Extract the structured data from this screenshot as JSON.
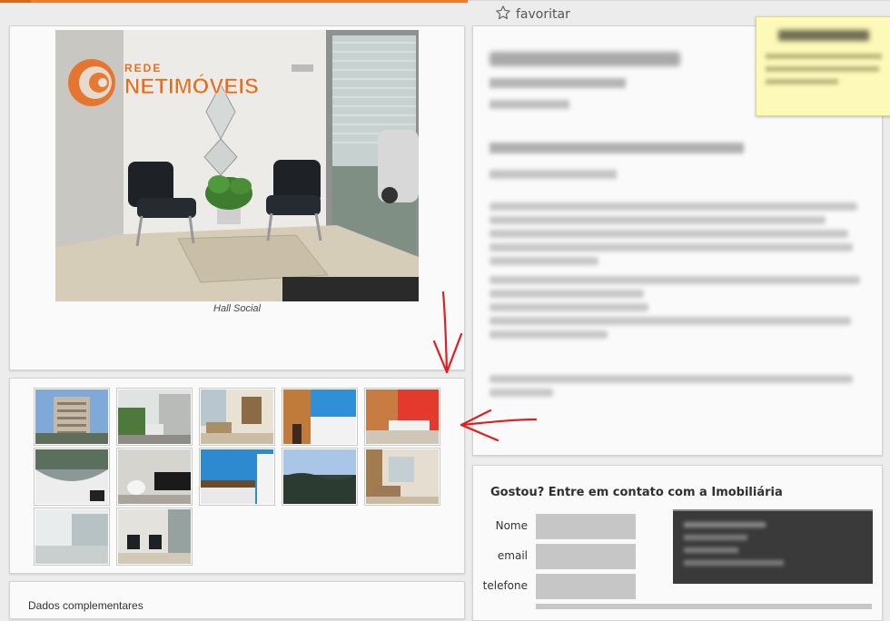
{
  "header": {
    "favorite_label": "favoritar",
    "accent_color": "#ee7d2b"
  },
  "gallery": {
    "logo_top": "REDE",
    "logo_main": "NETIMÓVEIS",
    "caption": "Hall Social",
    "thumbnails": [
      "building-exterior",
      "residential-entrance",
      "living-room",
      "kitchen-blue-wall",
      "bedroom-red-wall",
      "curved-balcony",
      "bathroom",
      "kitchen-counter",
      "city-view",
      "living-room-sofa",
      "empty-room",
      "lobby-chairs"
    ]
  },
  "contact": {
    "title": "Gostou? Entre em contato com a Imobiliária",
    "fields": {
      "name_label": "Nome",
      "email_label": "email",
      "phone_label": "telefone"
    }
  },
  "extra": {
    "section_title": "Dados complementares"
  },
  "annotations": {
    "arrow_color": "#e02020"
  }
}
